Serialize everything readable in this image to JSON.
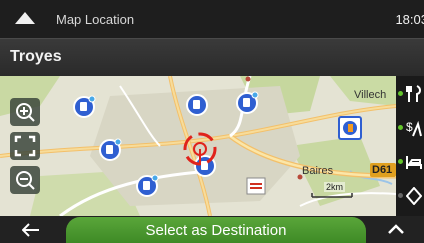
{
  "statusbar": {
    "title": "Map Location",
    "time": "18:03"
  },
  "location": {
    "name": "Troyes"
  },
  "map": {
    "labels": {
      "villech": "Villech",
      "baires": "Baires",
      "road": "D61",
      "scale": "2km"
    }
  },
  "bottom": {
    "select_label": "Select as Destination"
  },
  "colors": {
    "accent_green": "#4c9a2f",
    "poi_blue": "#2f5fd1",
    "cursor_red": "#e0231b"
  },
  "icons": [
    "collapse-icon",
    "zoom-in-icon",
    "fit-view-icon",
    "zoom-out-icon",
    "back-arrow-icon",
    "expand-up-icon",
    "fuel-poi-icon",
    "shop-poi-icon"
  ]
}
